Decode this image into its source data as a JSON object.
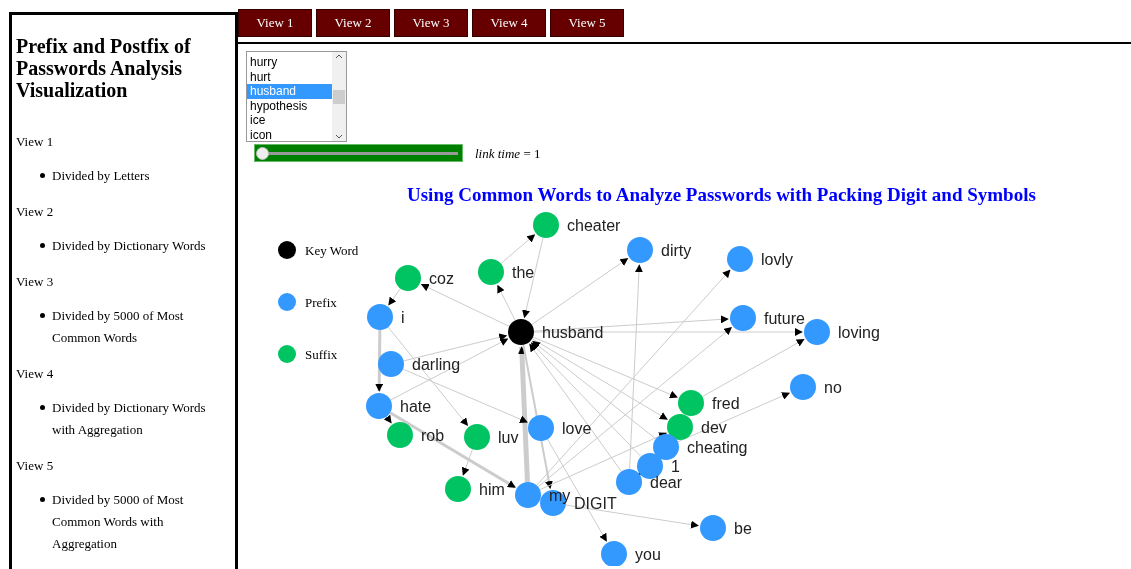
{
  "sidebar": {
    "title": "Prefix and Postfix of Passwords Analysis Visualization",
    "views": [
      {
        "label": "View 1",
        "items": [
          "Divided by Letters"
        ]
      },
      {
        "label": "View 2",
        "items": [
          "Divided by Dictionary Words"
        ]
      },
      {
        "label": "View 3",
        "items": [
          "Divided by 5000 of Most Common Words"
        ]
      },
      {
        "label": "View 4",
        "items": [
          "Divided by Dictionary Words with Aggregation"
        ]
      },
      {
        "label": "View 5",
        "items": [
          "Divided by 5000 of Most Common Words with Aggregation"
        ]
      }
    ]
  },
  "tabs": [
    "View 1",
    "View 2",
    "View 3",
    "View 4",
    "View 5"
  ],
  "word_list": {
    "items": [
      {
        "label": "hurry",
        "selected": false
      },
      {
        "label": "hurt",
        "selected": false
      },
      {
        "label": "husband",
        "selected": true
      },
      {
        "label": "hypothesis",
        "selected": false
      },
      {
        "label": "ice",
        "selected": false
      },
      {
        "label": "icon",
        "selected": false
      }
    ]
  },
  "link_slider": {
    "level": 0,
    "label": "link time",
    "reading": "= 1"
  },
  "graph": {
    "title": "Using Common Words to Analyze Passwords with Packing Digit and Symbols",
    "legend": [
      {
        "kind": "key",
        "label": "Key Word"
      },
      {
        "kind": "prefix",
        "label": "Prefix"
      },
      {
        "kind": "suffix",
        "label": "Suffix"
      }
    ],
    "nodes": [
      {
        "kind": "suffix",
        "label": "cheater"
      },
      {
        "kind": "prefix",
        "label": "dirty"
      },
      {
        "kind": "prefix",
        "label": "lovly"
      },
      {
        "kind": "suffix",
        "label": "the"
      },
      {
        "kind": "suffix",
        "label": "coz"
      },
      {
        "kind": "prefix",
        "label": "i"
      },
      {
        "kind": "prefix",
        "label": "future"
      },
      {
        "kind": "key",
        "label": "husband"
      },
      {
        "kind": "prefix",
        "label": "loving"
      },
      {
        "kind": "prefix",
        "label": "darling"
      },
      {
        "kind": "prefix",
        "label": "no"
      },
      {
        "kind": "suffix",
        "label": "fred"
      },
      {
        "kind": "prefix",
        "label": "hate"
      },
      {
        "kind": "suffix",
        "label": "dev"
      },
      {
        "kind": "prefix",
        "label": "love"
      },
      {
        "kind": "suffix",
        "label": "rob"
      },
      {
        "kind": "suffix",
        "label": "luv"
      },
      {
        "kind": "prefix",
        "label": "cheating"
      },
      {
        "kind": "prefix",
        "label": "1"
      },
      {
        "kind": "prefix",
        "label": "dear"
      },
      {
        "kind": "suffix",
        "label": "him"
      },
      {
        "kind": "prefix",
        "label": "my"
      },
      {
        "kind": "prefix",
        "label": "DIGIT"
      },
      {
        "kind": "prefix",
        "label": "be"
      },
      {
        "kind": "prefix",
        "label": "you"
      }
    ]
  }
}
